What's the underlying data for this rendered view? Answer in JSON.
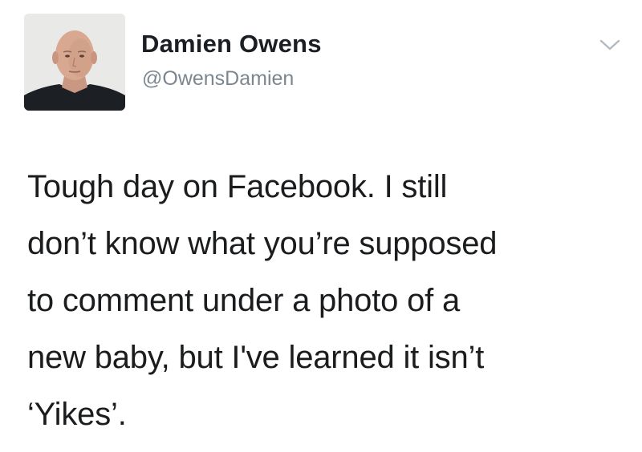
{
  "tweet": {
    "author": {
      "display_name": "Damien Owens",
      "handle": "@OwensDamien",
      "avatar": "profile-photo"
    },
    "menu_icon": "chevron-down-icon",
    "text_lines": [
      "Tough day on Facebook. I still",
      "don’t know what you’re supposed",
      "to comment under a photo of a",
      "new baby, but I've learned it isn’t",
      "‘Yikes’."
    ]
  }
}
